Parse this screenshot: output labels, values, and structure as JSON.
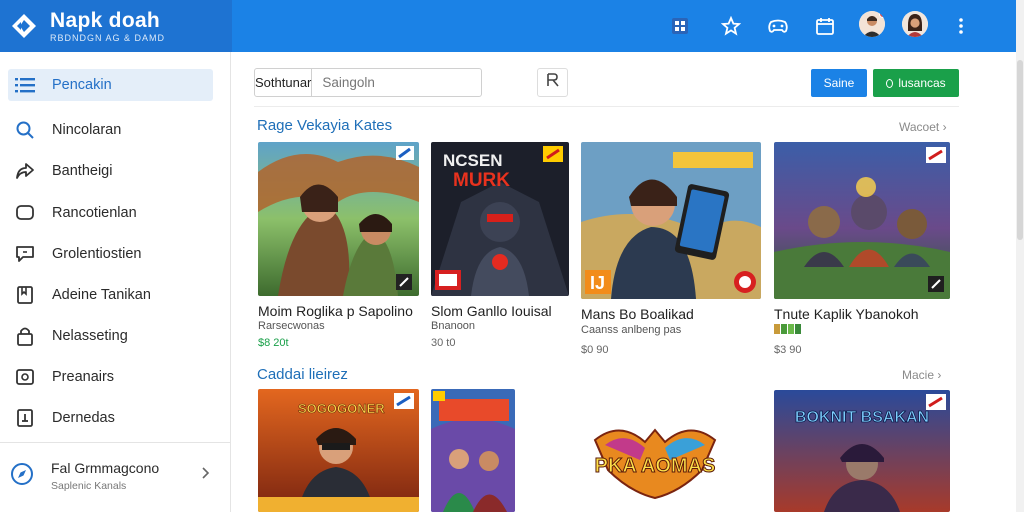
{
  "brand": {
    "title": "Napk doah",
    "subtitle": "RBDNDGN AG & DAMD"
  },
  "header": {
    "icons": [
      "grid-icon",
      "star-icon",
      "gamepad-icon",
      "calendar-icon",
      "avatar",
      "avatar",
      "more-vertical-icon"
    ]
  },
  "sidebar": {
    "items": [
      {
        "label": "Pencakin",
        "icon": "list-icon",
        "active": true
      },
      {
        "label": "Nincolaran",
        "icon": "search-icon"
      },
      {
        "label": "Bantheigi",
        "icon": "share-icon"
      },
      {
        "label": "Rancotienlan",
        "icon": "chat-icon"
      },
      {
        "label": "Grolentiostien",
        "icon": "message-icon"
      },
      {
        "label": "Adeine Tanikan",
        "icon": "bookmark-icon"
      },
      {
        "label": "Nelasseting",
        "icon": "lock-icon"
      },
      {
        "label": "Preanairs",
        "icon": "image-icon"
      },
      {
        "label": "Dernedas",
        "icon": "download-icon"
      }
    ],
    "footer": {
      "title": "Fal Grmmagcono",
      "subtitle": "Saplenic Kanals"
    }
  },
  "toolbar": {
    "segment_label": "Sothtunar",
    "search_placeholder": "Saingoln",
    "blue_button": "Saine",
    "green_button": "lusancas"
  },
  "sections": [
    {
      "title": "Rage Vekayia Kates",
      "more": "Wacoet",
      "cards": [
        {
          "title": "Moim Roglika p Sapolino",
          "subtitle": "Rarsecwonas",
          "price": "$8 20t",
          "price_color": "green"
        },
        {
          "title": "Slom Ganllo Iouisal",
          "subtitle": "Bnanoon",
          "price": "30 t0",
          "price_color": "grey"
        },
        {
          "title": "Mans Bo Boalikad",
          "subtitle": "Caanss anlbeng pas",
          "price": "$0 90",
          "price_color": "grey"
        },
        {
          "title": "Tnute Kaplik Ybanokoh",
          "subtitle": "",
          "price": "$3 90",
          "price_color": "grey"
        }
      ]
    },
    {
      "title": "Caddai lieirez",
      "more": "Macie",
      "cards": [
        {
          "title": "",
          "subtitle": "",
          "price": ""
        },
        {
          "title": "",
          "subtitle": "",
          "price": ""
        },
        {
          "title": "",
          "subtitle": "",
          "price": ""
        },
        {
          "title": "",
          "subtitle": "",
          "price": ""
        }
      ],
      "art_text": [
        "SOGOGONER",
        "PKA AOMAS",
        "BOKNIT BSAKAN"
      ]
    }
  ],
  "colors": {
    "brand": "#1e73d2",
    "header": "#1b82e6",
    "accent": "#1f6fb8",
    "green": "#1aa04a"
  }
}
